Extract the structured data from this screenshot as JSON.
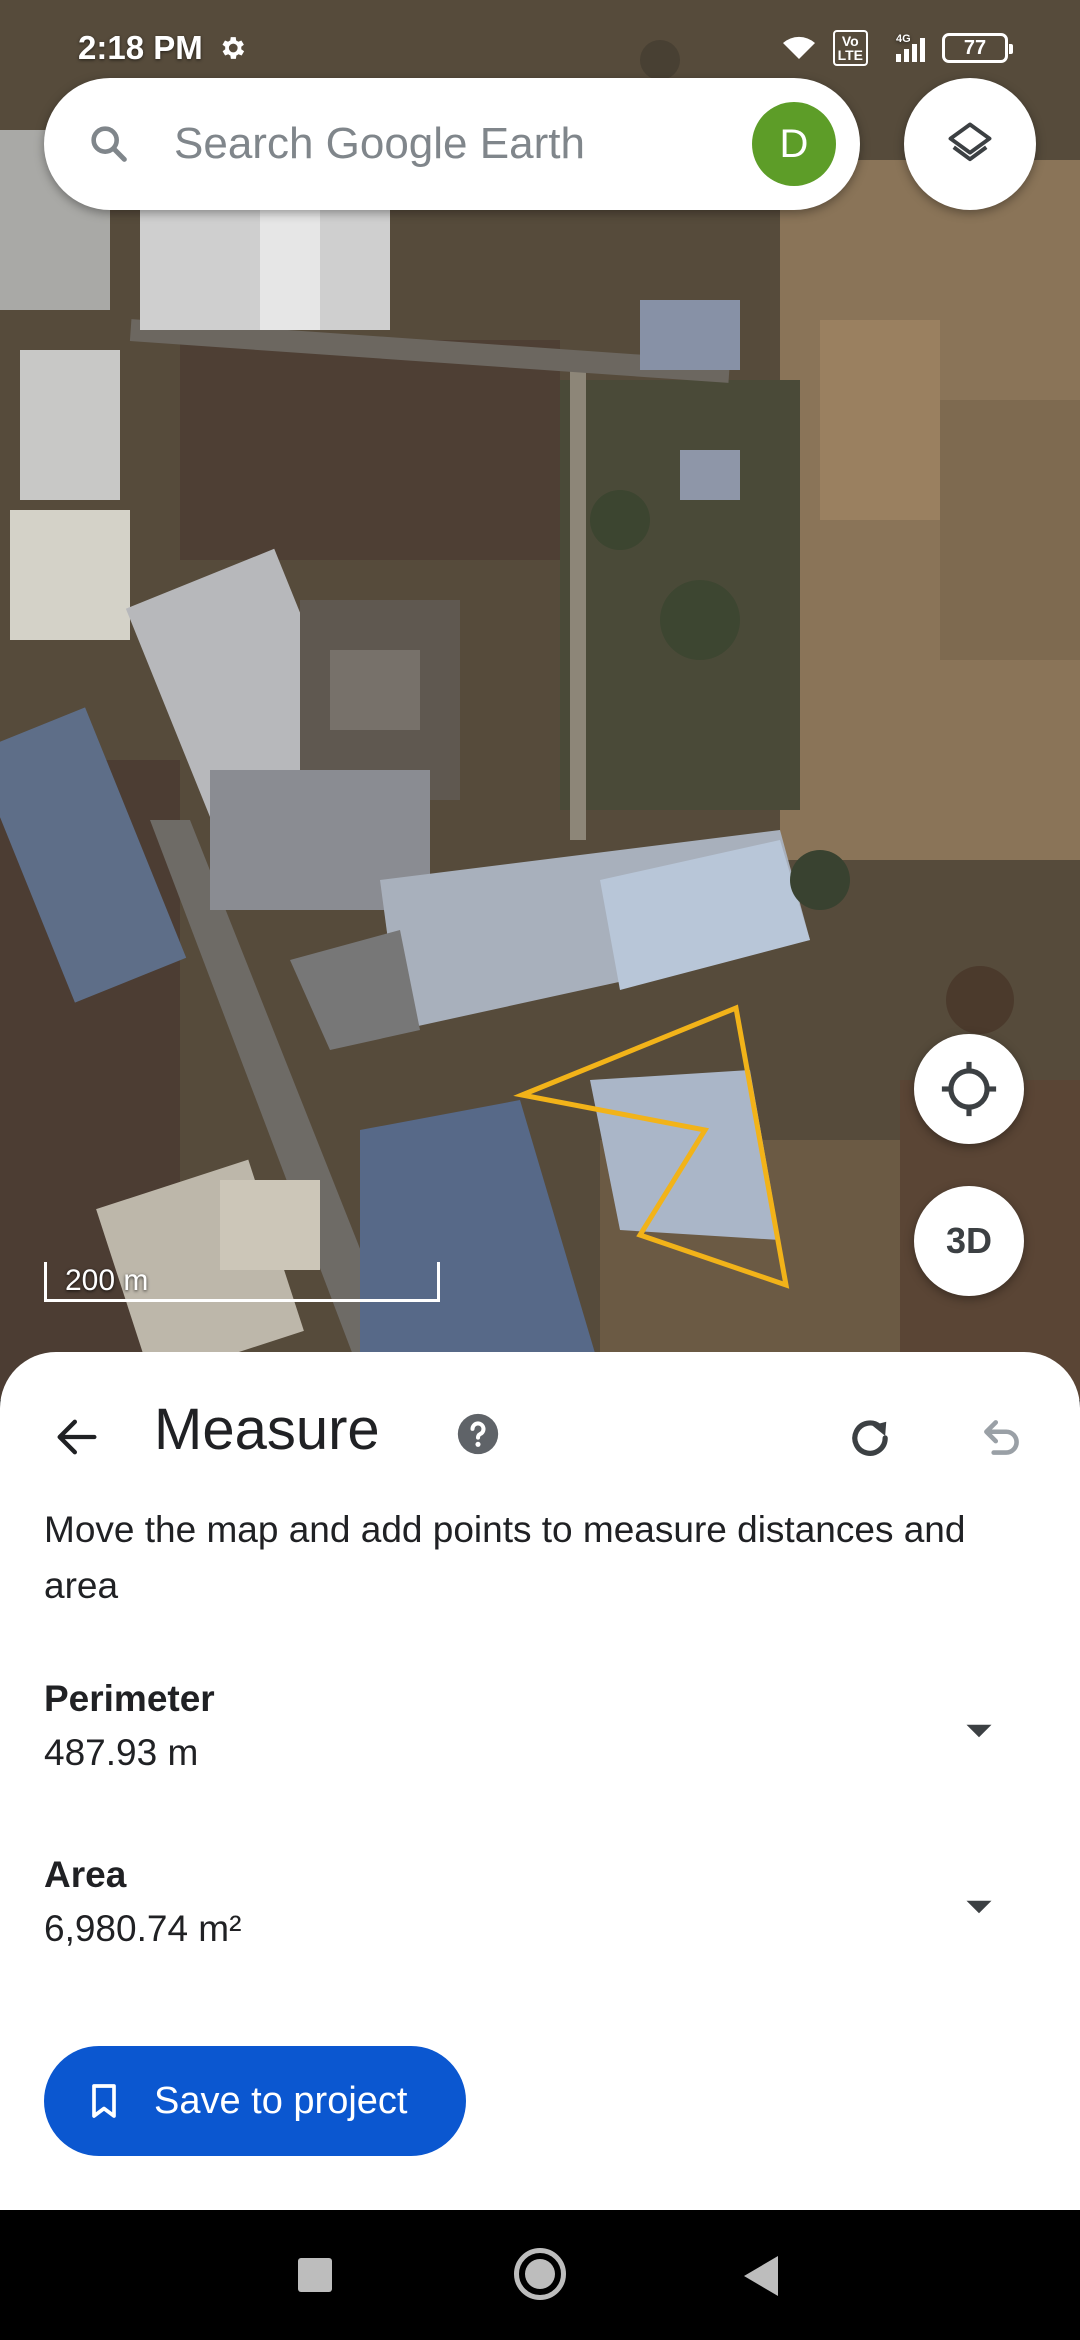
{
  "status_bar": {
    "time": "2:18 PM",
    "lte": "Vo\nLTE",
    "network": "4G",
    "battery": "77"
  },
  "search": {
    "placeholder": "Search Google Earth",
    "avatar_letter": "D",
    "avatar_color": "#5d9d28"
  },
  "map": {
    "scale_label": "200 m",
    "threed_label": "3D",
    "measure_outline_color": "#f2b319"
  },
  "measure": {
    "title": "Measure",
    "instructions": "Move the map and add points to measure distances and area",
    "perimeter_label": "Perimeter",
    "perimeter_value": "487.93 m",
    "area_label": "Area",
    "area_value": "6,980.74 m²",
    "save_label": "Save to project",
    "accent_color": "#0b57d0"
  },
  "icons": {
    "back": "arrow-back-icon",
    "help": "help-icon",
    "redo": "redo-icon",
    "undo": "undo-icon",
    "layers": "layers-icon",
    "locate": "my-location-icon",
    "bookmark": "bookmark-icon",
    "dropdown": "dropdown-icon"
  }
}
